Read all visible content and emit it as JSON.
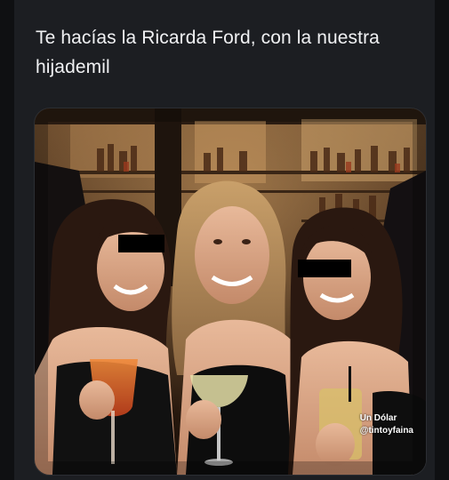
{
  "post": {
    "text": "Te hacías la Ricarda Ford, con la nuestra hijademil"
  },
  "media": {
    "watermark_line1": "Un Dólar",
    "watermark_line2": "@tintoyfaina"
  },
  "colors": {
    "background": "#16181c",
    "post_background": "#1c1e22",
    "text": "#f0f1f3"
  }
}
